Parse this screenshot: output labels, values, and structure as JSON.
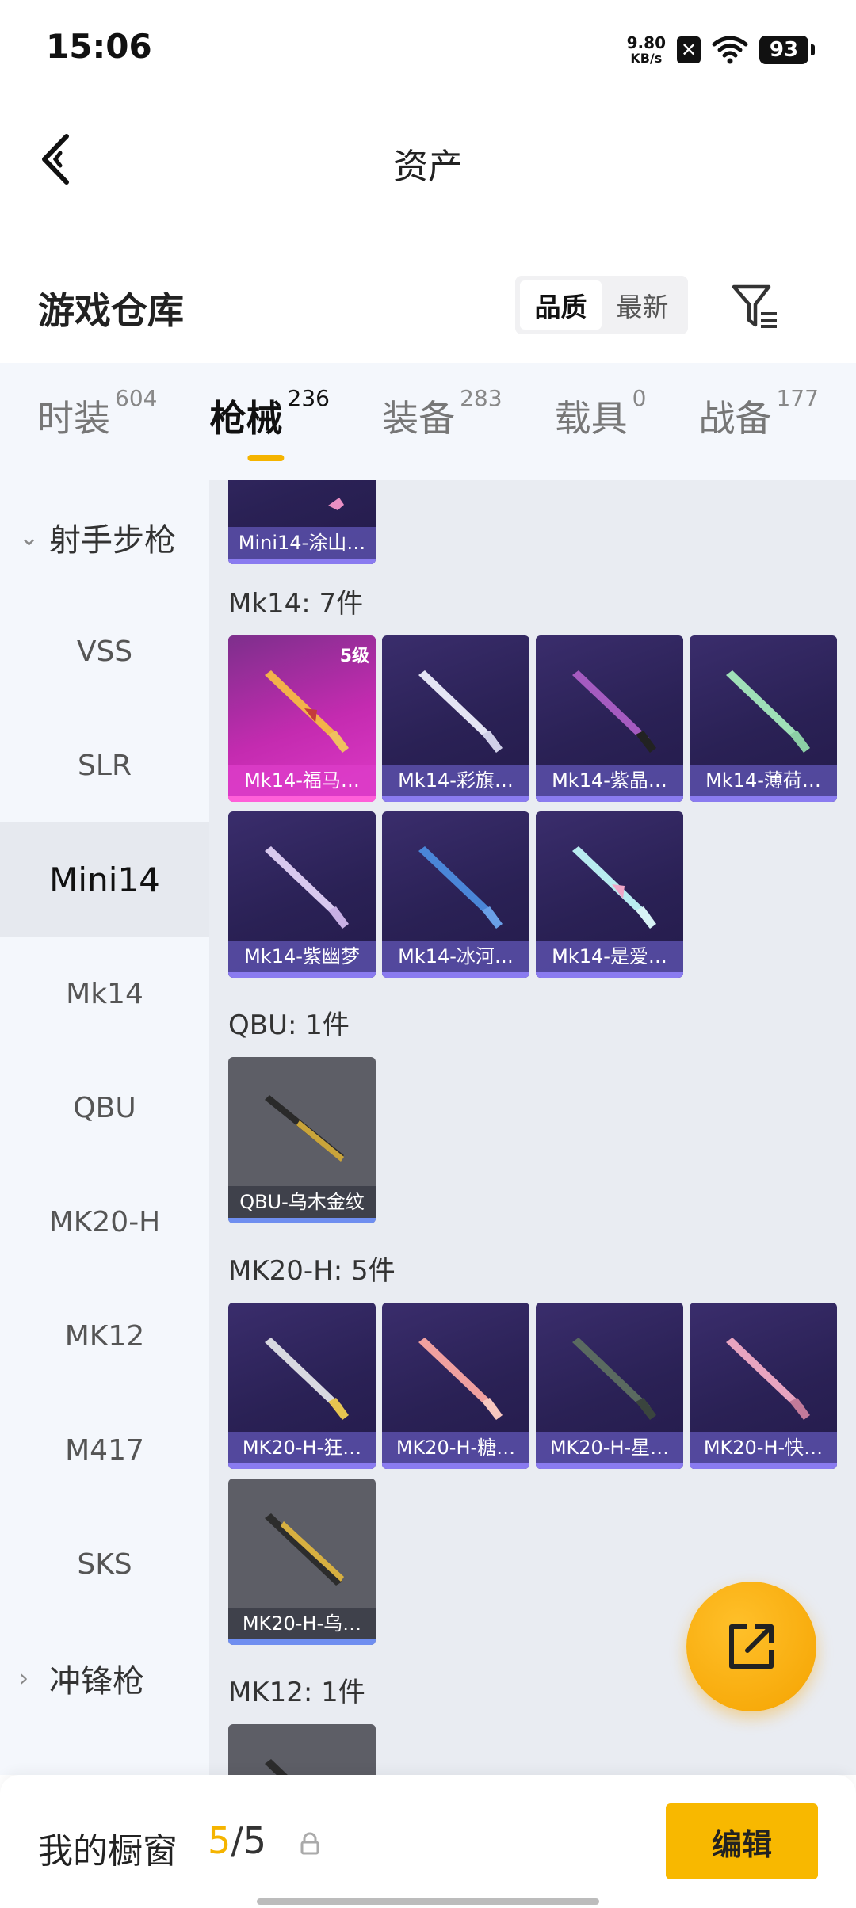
{
  "status_bar": {
    "time": "15:06",
    "net_speed": "9.80",
    "net_unit": "KB/s",
    "battery": "93"
  },
  "header": {
    "title": "资产"
  },
  "warehouse": {
    "title": "游戏仓库",
    "sort_quality": "品质",
    "sort_latest": "最新"
  },
  "tabs": [
    {
      "label": "时装",
      "count": "604"
    },
    {
      "label": "枪械",
      "count": "236"
    },
    {
      "label": "装备",
      "count": "283"
    },
    {
      "label": "载具",
      "count": "0"
    },
    {
      "label": "战备",
      "count": "177"
    }
  ],
  "sidebar": {
    "group_open": "射手步枪",
    "items": [
      "VSS",
      "SLR",
      "Mini14",
      "Mk14",
      "QBU",
      "MK20-H",
      "MK12",
      "M417",
      "SKS"
    ],
    "group_closed": "冲锋枪"
  },
  "content": {
    "top_partial_card": "Mini14-涂山…",
    "sections": [
      {
        "title": "Mk14: 7件",
        "cards": [
          {
            "label": "Mk14-福马…",
            "level": "5级"
          },
          {
            "label": "Mk14-彩旗…"
          },
          {
            "label": "Mk14-紫晶…"
          },
          {
            "label": "Mk14-薄荷…"
          },
          {
            "label": "Mk14-紫幽梦"
          },
          {
            "label": "Mk14-冰河…"
          },
          {
            "label": "Mk14-是爱…"
          }
        ]
      },
      {
        "title": "QBU: 1件",
        "cards": [
          {
            "label": "QBU-乌木金纹"
          }
        ]
      },
      {
        "title": "MK20-H: 5件",
        "cards": [
          {
            "label": "MK20-H-狂…"
          },
          {
            "label": "MK20-H-糖…"
          },
          {
            "label": "MK20-H-星…"
          },
          {
            "label": "MK20-H-快…"
          },
          {
            "label": "MK20-H-乌…"
          }
        ]
      },
      {
        "title": "MK12: 1件",
        "cards": []
      }
    ]
  },
  "bottom_bar": {
    "label": "我的橱窗",
    "current": "5",
    "total": "/5",
    "edit": "编辑"
  },
  "colors": {
    "accent": "#f5b400",
    "sidebar_bg": "#f4f7fc",
    "content_bg": "#e9ecf2"
  }
}
